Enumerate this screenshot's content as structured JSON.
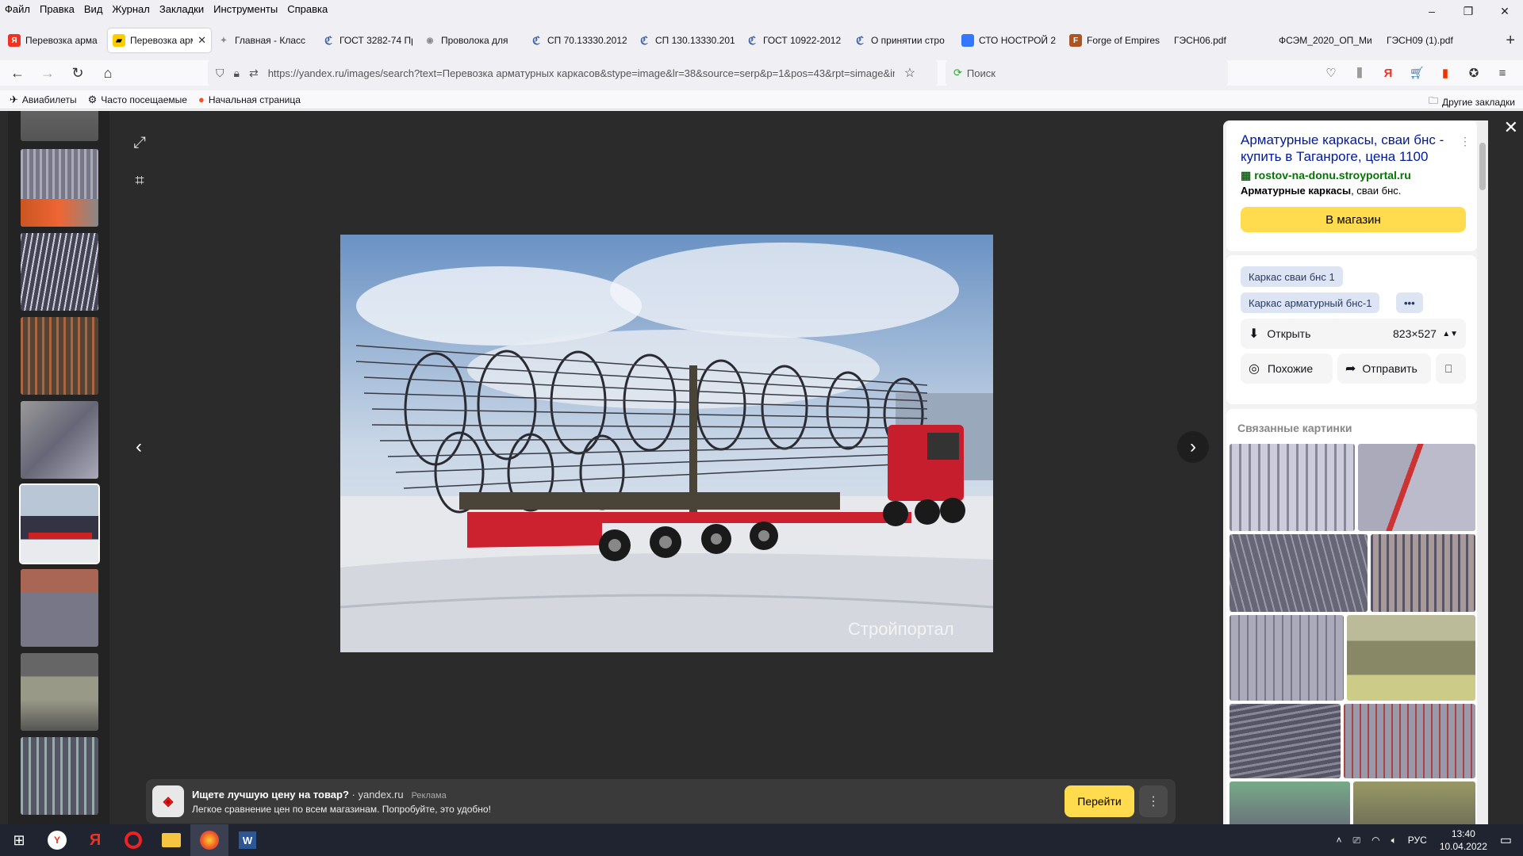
{
  "menubar": {
    "items": [
      "Файл",
      "Правка",
      "Вид",
      "Журнал",
      "Закладки",
      "Инструменты",
      "Справка"
    ]
  },
  "window_controls": {
    "minimize": "–",
    "restore": "❐",
    "close": "✕"
  },
  "tabs": [
    {
      "label": "Перевозка арма",
      "icon": "yandex-icon",
      "color": "#e32"
    },
    {
      "label": "Перевозка армат",
      "icon": "yandex-images-icon",
      "color": "#fc0",
      "active": true
    },
    {
      "label": "Главная - Класс",
      "icon": "globe-icon",
      "color": "#888"
    },
    {
      "label": "ГОСТ 3282-74 Пр",
      "icon": "doc-icon",
      "color": "#46a"
    },
    {
      "label": "Проволока для",
      "icon": "globe-icon",
      "color": "#888"
    },
    {
      "label": "СП 70.13330.2012",
      "icon": "doc-icon",
      "color": "#46a"
    },
    {
      "label": "СП 130.13330.201",
      "icon": "doc-icon",
      "color": "#46a"
    },
    {
      "label": "ГОСТ 10922-2012",
      "icon": "doc-icon",
      "color": "#46a"
    },
    {
      "label": "О принятии стро",
      "icon": "doc-icon",
      "color": "#46a"
    },
    {
      "label": "СТО НОСТРОЙ 2",
      "icon": "blue-square-icon",
      "color": "#37f"
    },
    {
      "label": "Forge of Empires",
      "icon": "foe-icon",
      "color": "#a52"
    },
    {
      "label": "ГЭСН06.pdf",
      "icon": "",
      "color": ""
    },
    {
      "label": "ФСЭМ_2020_ОП_Ми",
      "icon": "",
      "color": ""
    },
    {
      "label": "ГЭСН09 (1).pdf",
      "icon": "",
      "color": ""
    }
  ],
  "new_tab": "+",
  "nav": {
    "url": "https://yandex.ru/images/search?text=Перевозка арматурных каркасов&stype=image&lr=38&source=serp&p=1&pos=43&rpt=simage&img_url=...",
    "search_placeholder": "Поиск"
  },
  "bookmarks": [
    {
      "label": "Авиабилеты",
      "icon": "plane-icon"
    },
    {
      "label": "Часто посещаемые",
      "icon": "gear-icon"
    },
    {
      "label": "Начальная страница",
      "icon": "firefox-icon"
    }
  ],
  "bookmarks_other": "Другие закладки",
  "ad": {
    "title": "Ищете лучшую цену на товар?",
    "source": "· yandex.ru",
    "tag": "Реклама",
    "text": "Легкое сравнение цен по всем магазинам. Попробуйте, это удобно!",
    "button": "Перейти"
  },
  "panel": {
    "title": "Арматурные каркасы, сваи бнс - купить в Таганроге, цена 1100",
    "site": "rostov-na-donu.stroyportal.ru",
    "desc_bold": "Арматурные каркасы",
    "desc_rest": ", сваи бнс.",
    "shop_button": "В магазин",
    "chips": [
      "Каркас сваи бнс 1",
      "Каркас арматурный бнс-1"
    ],
    "chip_more": "•••",
    "open_label": "Открыть",
    "size": "823×527",
    "similar": "Похожие",
    "send": "Отправить",
    "related_header": "Связанные картинки"
  },
  "watermark": "Стройпортал",
  "taskbar": {
    "lang": "РУС",
    "time": "13:40",
    "date": "10.04.2022"
  }
}
